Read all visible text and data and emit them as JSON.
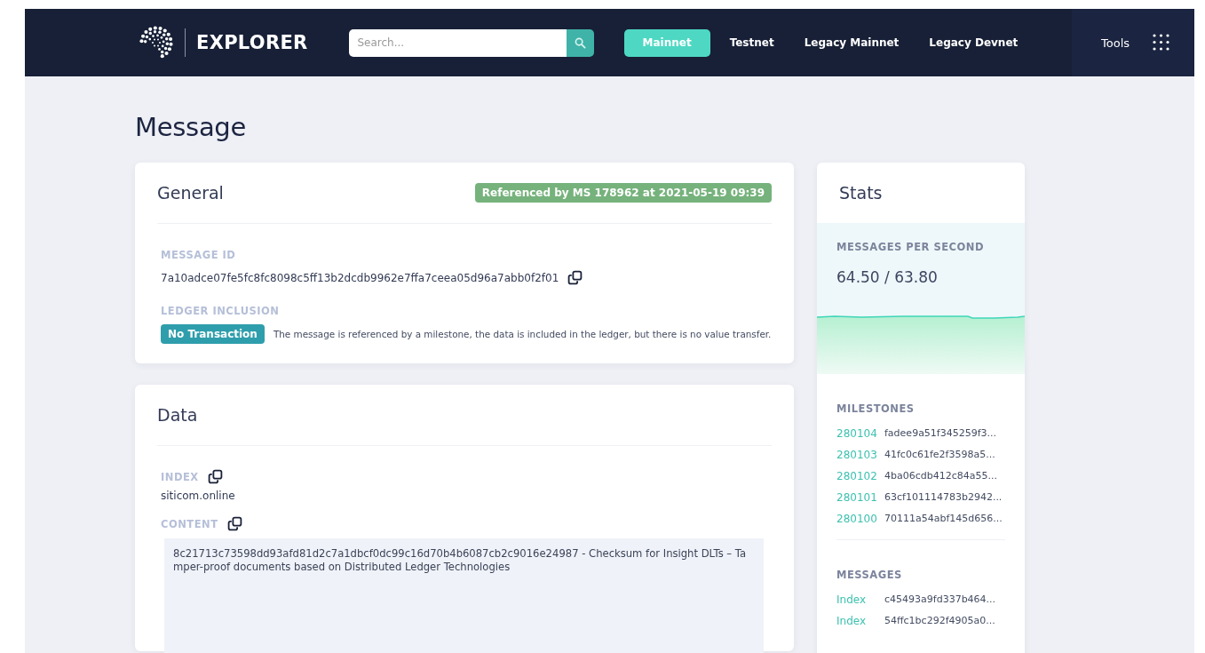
{
  "header": {
    "brand": "EXPLORER",
    "search": {
      "placeholder": "Search..."
    },
    "networks": [
      {
        "label": "Mainnet",
        "selected": true
      },
      {
        "label": "Testnet",
        "selected": false
      },
      {
        "label": "Legacy Mainnet",
        "selected": false
      },
      {
        "label": "Legacy Devnet",
        "selected": false
      }
    ],
    "tools": "Tools"
  },
  "page_title": "Message",
  "general": {
    "title": "General",
    "status_badge": "Referenced by MS 178962 at 2021-05-19 09:39",
    "message_id_label": "MESSAGE ID",
    "message_id": "7a10adce07fe5fc8fc8098c5ff13b2dcdb9962e7ffa7ceea05d96a7abb0f2f01",
    "ledger_label": "LEDGER INCLUSION",
    "ledger_badge": "No Transaction",
    "ledger_text": "The message is referenced by a milestone, the data is included in the ledger, but there is no value transfer."
  },
  "data": {
    "title": "Data",
    "index_label": "INDEX",
    "index": "siticom.online",
    "content_label": "CONTENT",
    "content": "8c21713c73598dd93afd81d2c7a1dbcf0dc99c16d70b4b6087cb2c9016e24987 - Checksum for Insight DLTs – Tamper-proof documents based on Distributed Ledger Technologies"
  },
  "stats": {
    "title": "Stats",
    "mps_label": "MESSAGES PER SECOND",
    "mps_value": "64.50 / 63.80",
    "milestones_label": "MILESTONES",
    "milestones": [
      {
        "index": "280104",
        "id": "fadee9a51f345259f3..."
      },
      {
        "index": "280103",
        "id": "41fc0c61fe2f3598a5..."
      },
      {
        "index": "280102",
        "id": "4ba06cdb412c84a55..."
      },
      {
        "index": "280101",
        "id": "63cf101114783b2942..."
      },
      {
        "index": "280100",
        "id": "70111a54abf145d656..."
      }
    ],
    "messages_label": "MESSAGES",
    "messages": [
      {
        "type": "Index",
        "id": "c45493a9fd337b464..."
      },
      {
        "type": "Index",
        "id": "54ffc1bc292f4905a0..."
      }
    ]
  }
}
